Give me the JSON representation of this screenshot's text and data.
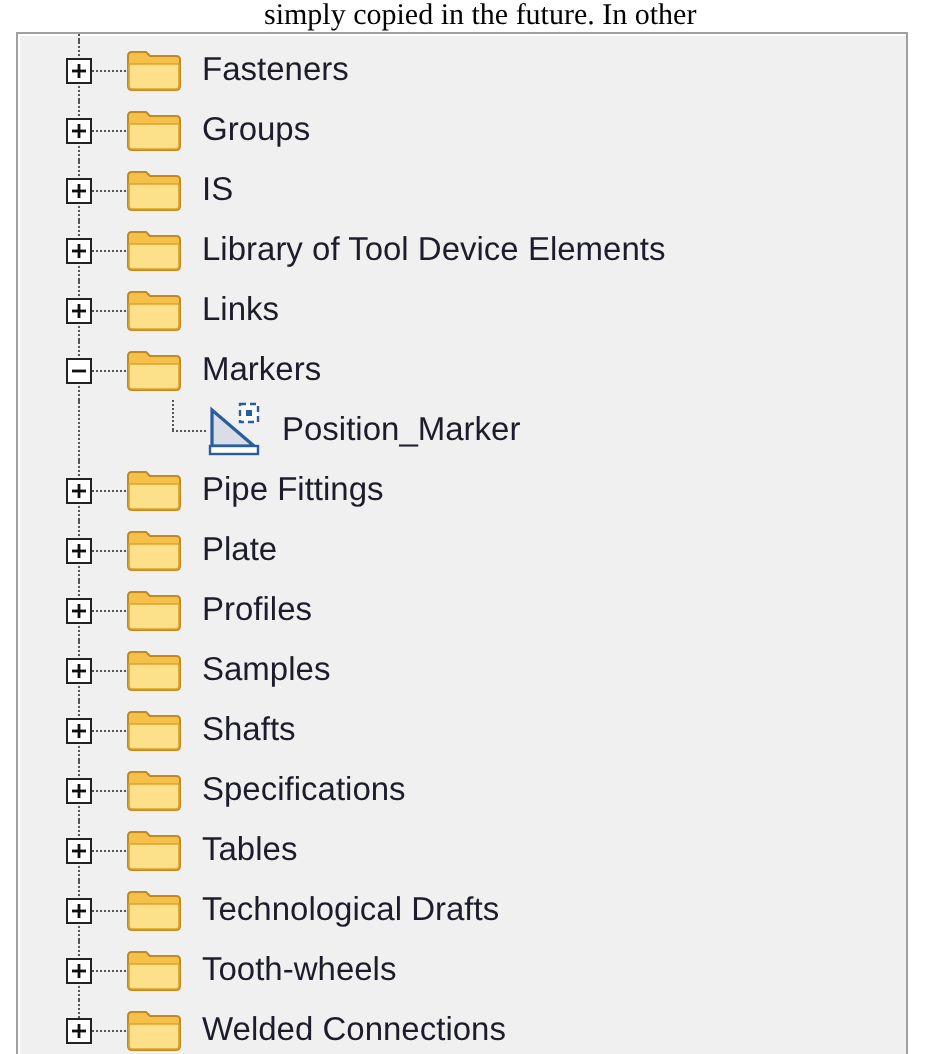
{
  "caption": "simply copied in the future. In other",
  "tree": [
    {
      "label": "Fasteners",
      "expanded": false
    },
    {
      "label": "Groups",
      "expanded": false
    },
    {
      "label": "IS",
      "expanded": false
    },
    {
      "label": "Library of Tool Device Elements",
      "expanded": false
    },
    {
      "label": "Links",
      "expanded": false
    },
    {
      "label": "Markers",
      "expanded": true,
      "children": [
        {
          "label": "Position_Marker"
        }
      ]
    },
    {
      "label": "Pipe Fittings",
      "expanded": false
    },
    {
      "label": "Plate",
      "expanded": false
    },
    {
      "label": "Profiles",
      "expanded": false
    },
    {
      "label": "Samples",
      "expanded": false
    },
    {
      "label": "Shafts",
      "expanded": false
    },
    {
      "label": "Specifications",
      "expanded": false
    },
    {
      "label": "Tables",
      "expanded": false
    },
    {
      "label": "Technological Drafts",
      "expanded": false
    },
    {
      "label": "Tooth-wheels",
      "expanded": false
    },
    {
      "label": "Welded Connections",
      "expanded": false
    }
  ]
}
